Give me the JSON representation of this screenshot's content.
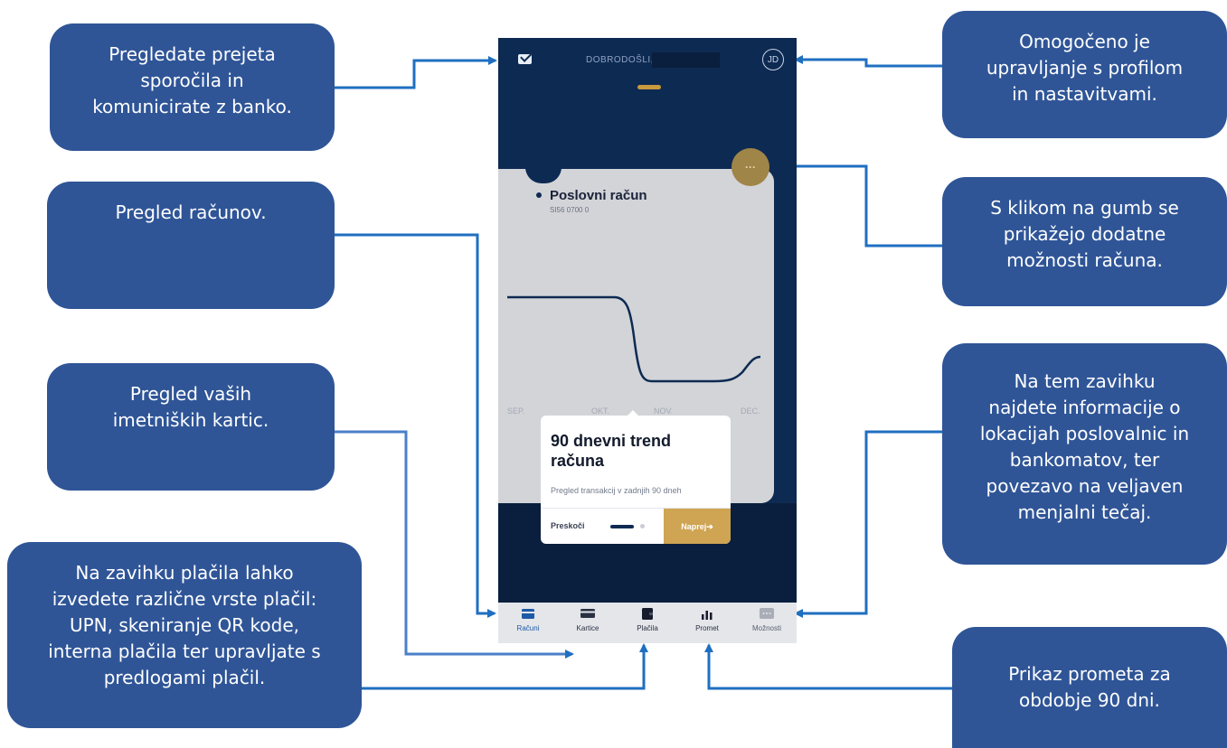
{
  "callouts": {
    "messages": [
      "Pregledate prejeta",
      "sporočila in",
      "komunicirate z banko."
    ],
    "profile": [
      "Omogočeno je",
      "upravljanje s profilom",
      "in nastavitvami."
    ],
    "accounts": [
      "Pregled računov."
    ],
    "more_options": [
      "S klikom na gumb se",
      "prikažejo dodatne",
      "možnosti računa."
    ],
    "cards": [
      "Pregled vaših",
      "imetniških kartic."
    ],
    "locations": [
      "Na tem zavihku",
      "najdete informacije o",
      "lokacijah poslovalnic in",
      "bankomatov, ter",
      "povezavo na veljaven",
      "menjalni tečaj."
    ],
    "payments": [
      "Na zavihku plačila lahko",
      "izvedete različne vrste plačil:",
      "UPN, skeniranje QR kode,",
      "interna plačila ter upravljate s",
      "predlogami plačil."
    ],
    "turnover": [
      "Prikaz prometa za",
      "obdobje 90 dni."
    ]
  },
  "app": {
    "welcome": "DOBRODOŠLI,",
    "avatar_initials": "JD",
    "more_button_label": "···",
    "account": {
      "name": "Poslovni račun",
      "iban": "SI56 0700 0"
    },
    "chart_months": [
      "SEP.",
      "OKT.",
      "NOV.",
      "DEC."
    ],
    "tooltip": {
      "title": "90 dnevni trend računa",
      "description": "Pregled transakcij v zadnjih 90 dneh",
      "skip": "Preskoči",
      "next": "Naprej➔"
    },
    "tabs": [
      {
        "label": "Računi",
        "icon": "wallet-card-icon"
      },
      {
        "label": "Kartice",
        "icon": "credit-card-icon"
      },
      {
        "label": "Plačila",
        "icon": "wallet-icon"
      },
      {
        "label": "Promet",
        "icon": "bar-chart-icon"
      },
      {
        "label": "Možnosti",
        "icon": "chat-dots-icon"
      }
    ]
  },
  "colors": {
    "callout_bg": "#2f5597",
    "arrow": "#1f6fc0",
    "phone_bg": "#0d2a52",
    "accent_gold": "#cfa452"
  }
}
